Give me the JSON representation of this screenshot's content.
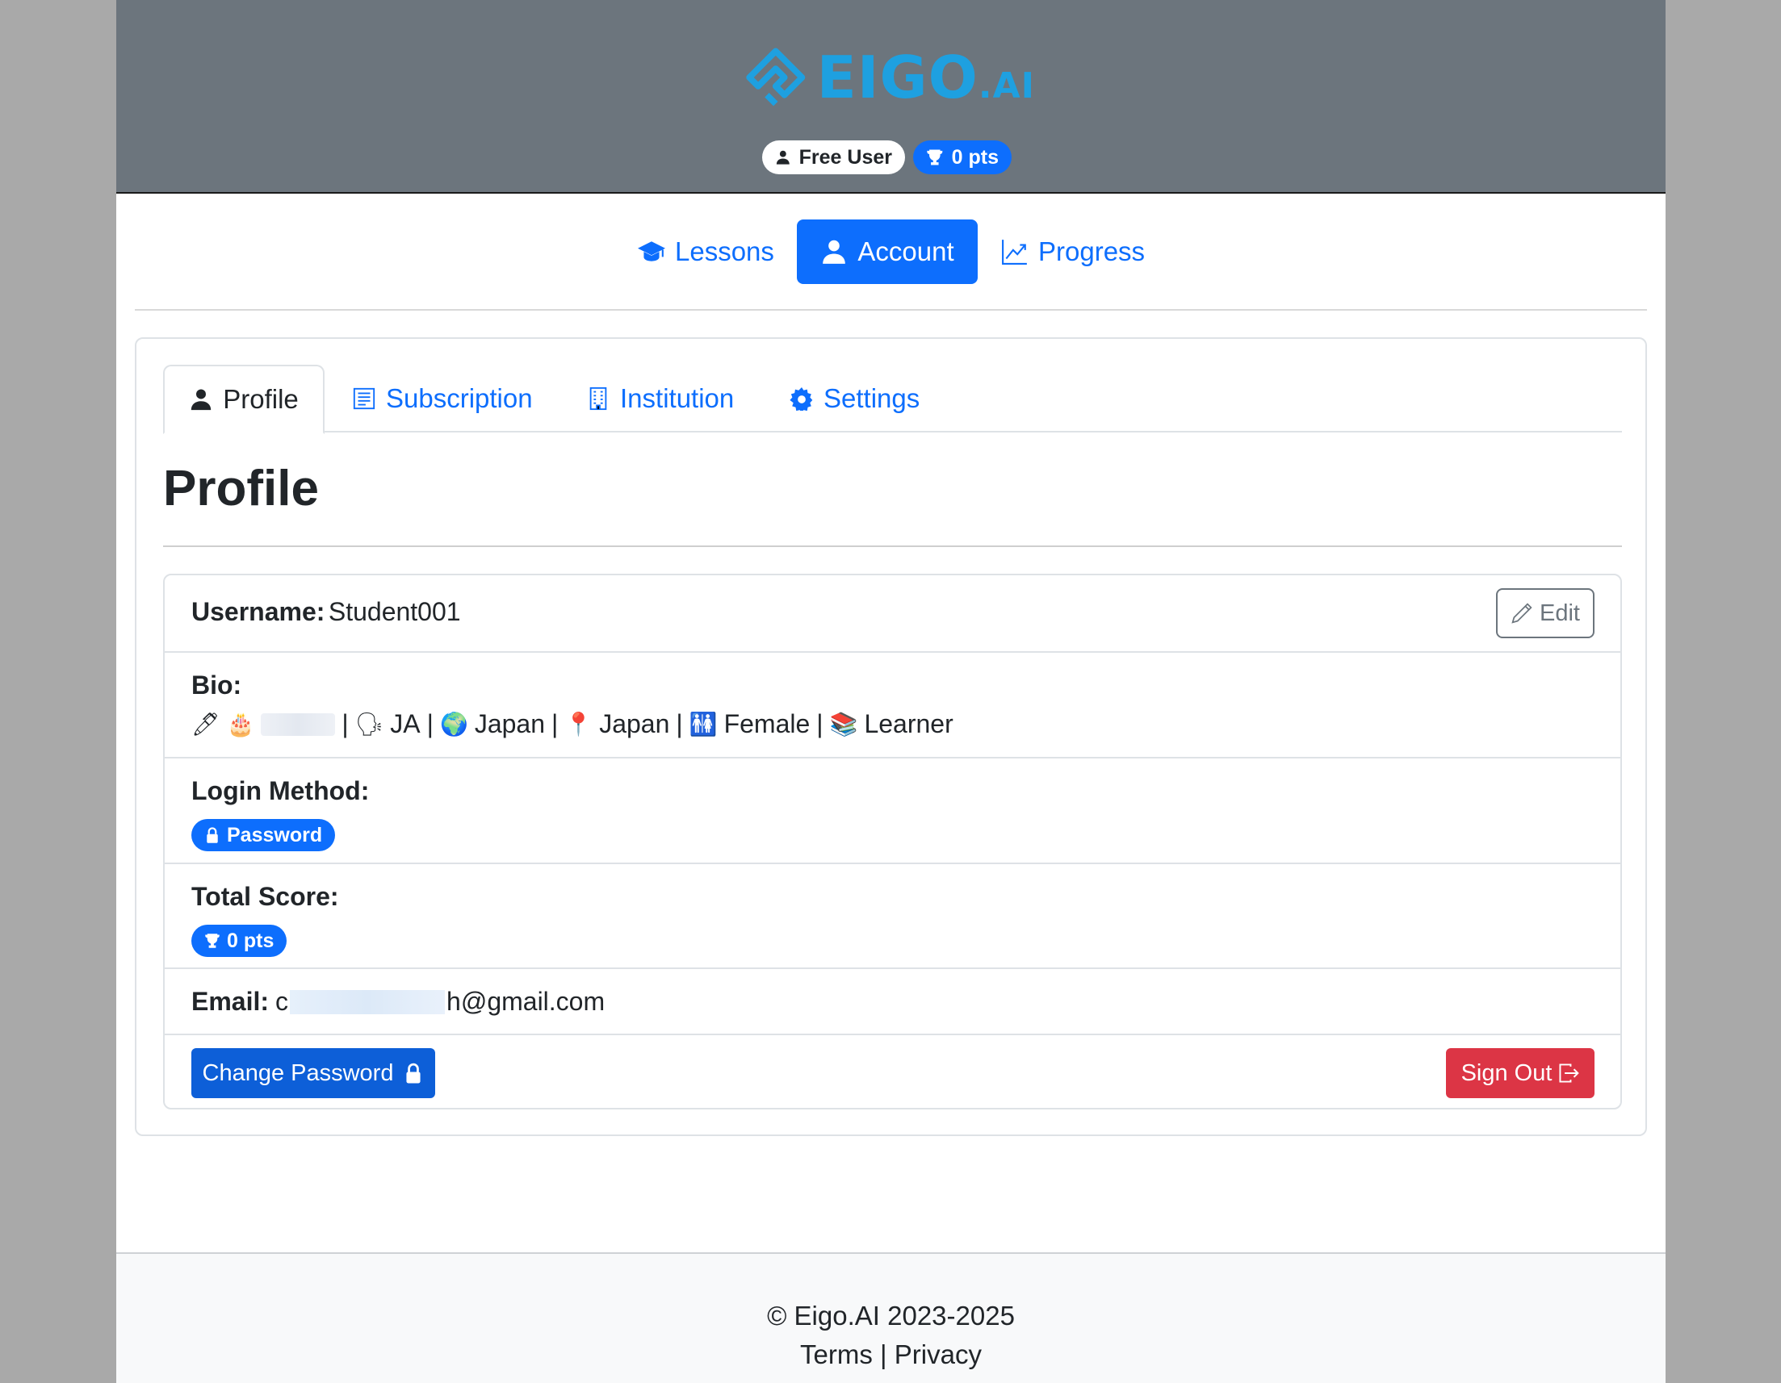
{
  "header": {
    "logo_main": "EIGO",
    "logo_suffix": ".AI",
    "user_type": "Free User",
    "points": "0 pts"
  },
  "nav": {
    "lessons": "Lessons",
    "account": "Account",
    "progress": "Progress"
  },
  "tabs": {
    "profile": "Profile",
    "subscription": "Subscription",
    "institution": "Institution",
    "settings": "Settings"
  },
  "profile": {
    "title": "Profile",
    "username_label": "Username:",
    "username_value": "Student001",
    "edit_label": "Edit",
    "bio_label": "Bio:",
    "bio": {
      "emoji_pencil": "🖊",
      "emoji_cake": "🎂",
      "sep": "|",
      "emoji_speak": "🗣",
      "language": "JA",
      "emoji_globe": "🌍",
      "country": "Japan",
      "emoji_pin": "📍",
      "location": "Japan",
      "emoji_gender": "🚻",
      "gender": "Female",
      "emoji_books": "📚",
      "role": "Learner"
    },
    "login_label": "Login Method:",
    "login_value": "Password",
    "score_label": "Total Score:",
    "score_value": "0 pts",
    "email_label": "Email:",
    "email_prefix": "c",
    "email_suffix": "h@gmail.com",
    "change_password": "Change Password",
    "sign_out": "Sign Out"
  },
  "footer": {
    "copyright": "© Eigo.AI 2023-2025",
    "terms": "Terms",
    "separator": "|",
    "privacy": "Privacy"
  },
  "colors": {
    "primary": "#0d6efd",
    "danger": "#dc3545",
    "header_bg": "#6c757d",
    "logo": "#1ea0e0"
  }
}
